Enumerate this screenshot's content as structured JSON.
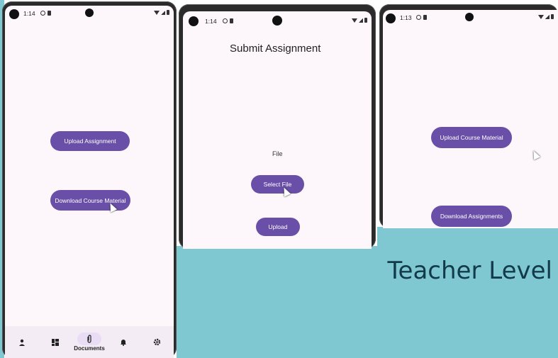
{
  "caption": "Teacher Level",
  "phone1": {
    "status_time": "1:14",
    "buttons": {
      "upload_assignment": "Upload Assignment",
      "download_course_material": "Download Course Material"
    },
    "nav": [
      {
        "label": "",
        "icon": "person-icon"
      },
      {
        "label": "",
        "icon": "dashboard-icon"
      },
      {
        "label": "Documents",
        "icon": "attachment-icon"
      },
      {
        "label": "",
        "icon": "bell-icon"
      },
      {
        "label": "",
        "icon": "gear-icon"
      }
    ]
  },
  "phone2": {
    "status_time": "1:14",
    "title": "Submit Assignment",
    "file_label": "File",
    "buttons": {
      "select_file": "Select File",
      "upload": "Upload"
    }
  },
  "phone3": {
    "status_time": "1:13",
    "buttons": {
      "upload_course_material": "Upload Course Material",
      "download_assignments": "Download Assignments"
    }
  },
  "colors": {
    "teal": "#7fc8d2",
    "button": "#6a4fa8",
    "screen_bg": "#fdf7fb",
    "caption": "#123a4a"
  }
}
